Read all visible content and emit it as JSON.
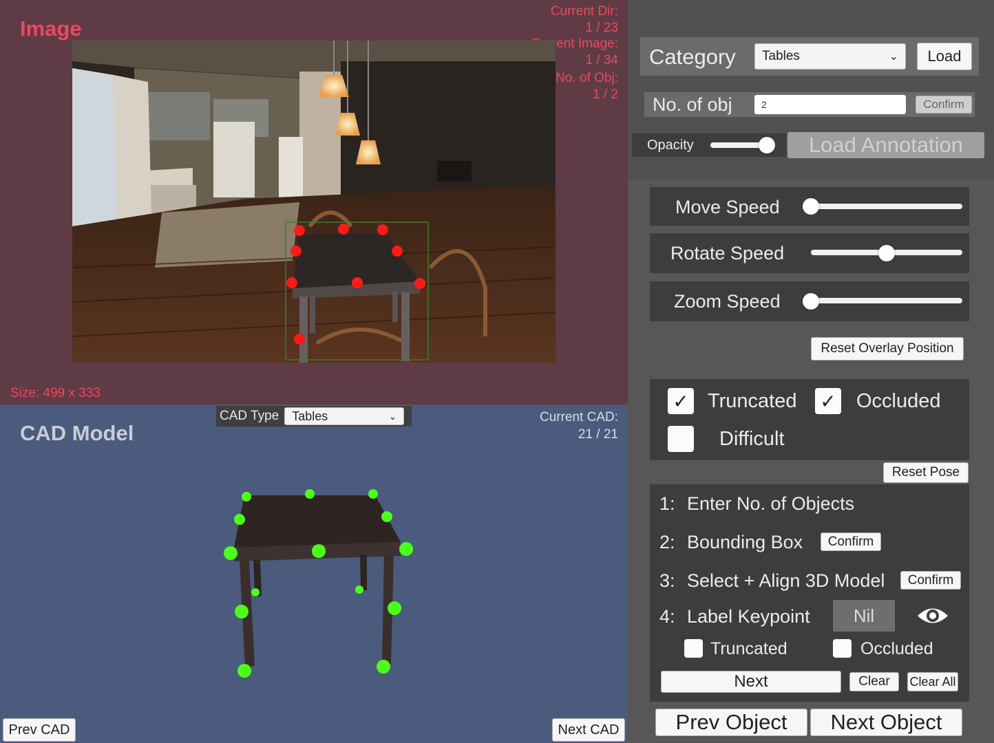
{
  "image_panel": {
    "title": "Image",
    "current_dir_label": "Current Dir:",
    "current_dir_value": "1 / 23",
    "current_image_label": "Current Image:",
    "current_image_value": "1 / 34",
    "num_obj_label": "No. of Obj:",
    "num_obj_value": "1 / 2",
    "size_label": "Size: 499 x 333"
  },
  "cad_panel": {
    "title": "CAD Model",
    "cad_type_label": "CAD Type",
    "cad_type_value": "Tables",
    "current_cad_label": "Current CAD:",
    "current_cad_value": "21 / 21",
    "prev_label": "Prev CAD",
    "next_label": "Next CAD"
  },
  "controls": {
    "category_label": "Category",
    "category_value": "Tables",
    "load_label": "Load",
    "num_obj_label": "No. of obj",
    "num_obj_value": "2",
    "confirm_label": "Confirm",
    "opacity_label": "Opacity",
    "opacity_value": 0.95,
    "load_annotation_label": "Load Annotation",
    "move_speed_label": "Move Speed",
    "move_speed_value": 0.0,
    "rotate_speed_label": "Rotate Speed",
    "rotate_speed_value": 0.5,
    "zoom_speed_label": "Zoom Speed",
    "zoom_speed_value": 0.0,
    "reset_overlay_label": "Reset Overlay Position",
    "truncated_label": "Truncated",
    "truncated_checked": true,
    "occluded_label": "Occluded",
    "occluded_checked": true,
    "difficult_label": "Difficult",
    "difficult_checked": false,
    "reset_pose_label": "Reset Pose"
  },
  "steps": {
    "step1_num": "1:",
    "step1_label": "Enter No. of Objects",
    "step2_num": "2:",
    "step2_label": "Bounding Box",
    "step2_button": "Confirm",
    "step3_num": "3:",
    "step3_label": "Select + Align 3D Model",
    "step3_button": "Confirm",
    "step4_num": "4:",
    "step4_label": "Label Keypoint",
    "keypoint_value": "Nil",
    "kp_truncated_label": "Truncated",
    "kp_occluded_label": "Occluded",
    "next_label": "Next",
    "clear_label": "Clear",
    "clear_all_label": "Clear All"
  },
  "navigation": {
    "prev_object_label": "Prev Object",
    "next_object_label": "Next Object"
  },
  "colors": {
    "image_panel_bg": "#5f3b46",
    "cad_panel_bg": "#4a5b7d",
    "accent_red": "#f0475c",
    "keypoint_red": "#ff1a1a",
    "keypoint_green": "#4cff1a"
  }
}
